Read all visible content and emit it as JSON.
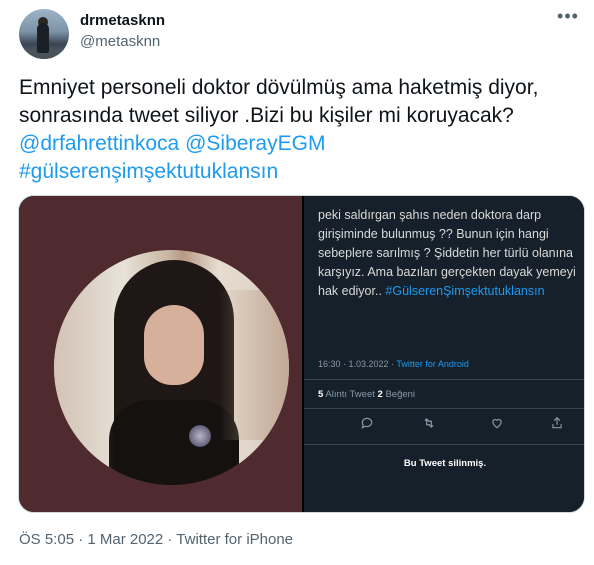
{
  "author": {
    "display_name": "drmetasknn",
    "handle": "@metasknn"
  },
  "tweet": {
    "text_line1": "Emniyet personeli doktor dövülmüş ama haketmiş diyor, sonrasında tweet siliyor .Bizi bu kişiler mi koruyacak?",
    "mention1": "@drfahrettinkoca",
    "mention2": "@SiberayEGM",
    "hashtag": "#gülserenşimşektutuklansın",
    "more_icon": "•••"
  },
  "screenshot": {
    "text": "peki saldırgan şahıs neden doktora darp girişiminde bulunmuş ?? Bunun için hangi sebeplere sarılmış ? Şiddetin her türlü olanına karşıyız. Ama bazıları gerçekten dayak yemeyi hak ediyor..",
    "hashtag": "#GülserenŞimşektutuklansın",
    "time": "16:30 · 1.03.2022 · ",
    "source": "Twitter for Android",
    "quote_count": "5",
    "quote_label": " Alıntı Tweet  ",
    "like_count": "2",
    "like_label": " Beğeni",
    "deleted_notice": "Bu Tweet silinmiş."
  },
  "footer": {
    "timestamp": "ÖS 5:05 · 1 Mar 2022 · Twitter for iPhone"
  },
  "colors": {
    "link": "#1d9bf0",
    "text": "#0f1419",
    "muted": "#536471",
    "dark_bg": "#15202b"
  }
}
